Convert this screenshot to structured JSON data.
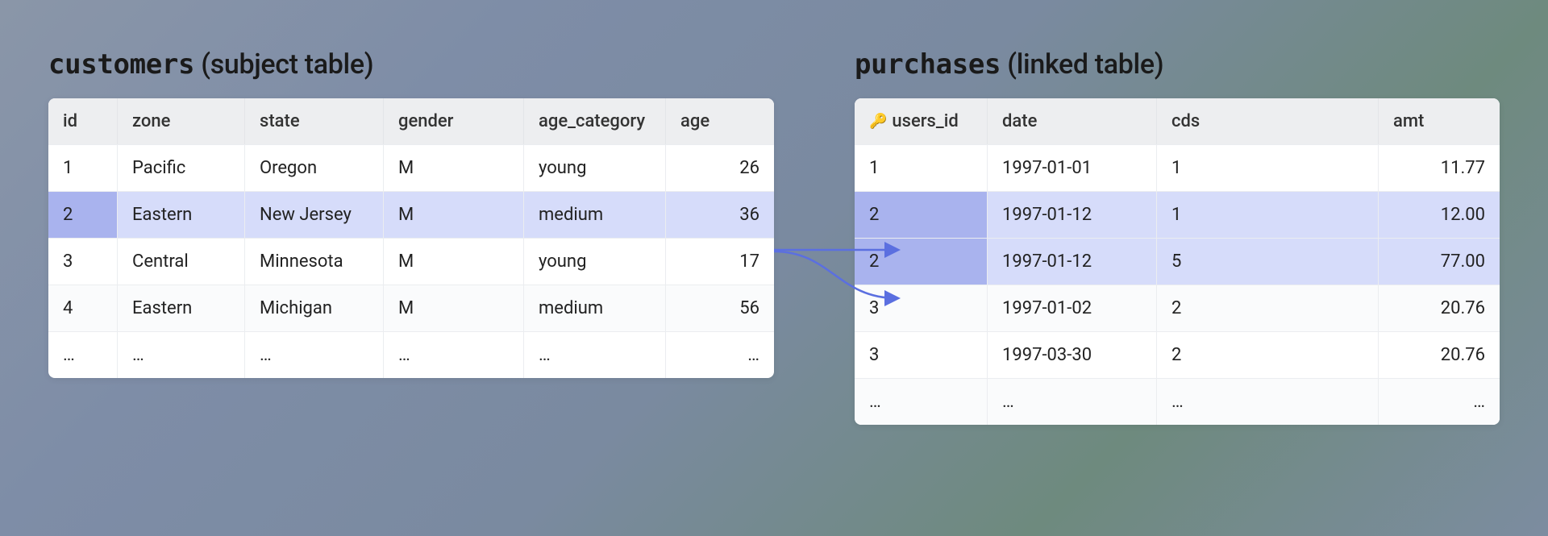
{
  "customers": {
    "title_mono": "customers",
    "title_rest": " (subject table)",
    "headers": [
      "id",
      "zone",
      "state",
      "gender",
      "age_category",
      "age"
    ],
    "rows": [
      {
        "cells": [
          "1",
          "Pacific",
          "Oregon",
          "M",
          "young",
          "26"
        ],
        "highlight": false
      },
      {
        "cells": [
          "2",
          "Eastern",
          "New Jersey",
          "M",
          "medium",
          "36"
        ],
        "highlight": true
      },
      {
        "cells": [
          "3",
          "Central",
          "Minnesota",
          "M",
          "young",
          "17"
        ],
        "highlight": false
      },
      {
        "cells": [
          "4",
          "Eastern",
          "Michigan",
          "M",
          "medium",
          "56"
        ],
        "highlight": false
      },
      {
        "cells": [
          "…",
          "…",
          "…",
          "…",
          "…",
          "…"
        ],
        "highlight": false
      }
    ]
  },
  "purchases": {
    "title_mono": "purchases",
    "title_rest": " (linked table)",
    "key_icon": "🔑",
    "headers": [
      "users_id",
      "date",
      "cds",
      "amt"
    ],
    "rows": [
      {
        "cells": [
          "1",
          "1997-01-01",
          "1",
          "11.77"
        ],
        "highlight": false
      },
      {
        "cells": [
          "2",
          "1997-01-12",
          "1",
          "12.00"
        ],
        "highlight": true
      },
      {
        "cells": [
          "2",
          "1997-01-12",
          "5",
          "77.00"
        ],
        "highlight": true
      },
      {
        "cells": [
          "3",
          "1997-01-02",
          "2",
          "20.76"
        ],
        "highlight": false
      },
      {
        "cells": [
          "3",
          "1997-03-30",
          "2",
          "20.76"
        ],
        "highlight": false
      },
      {
        "cells": [
          "…",
          "…",
          "…",
          "…"
        ],
        "highlight": false
      }
    ]
  },
  "link_arrow_color": "#5b6fe0"
}
